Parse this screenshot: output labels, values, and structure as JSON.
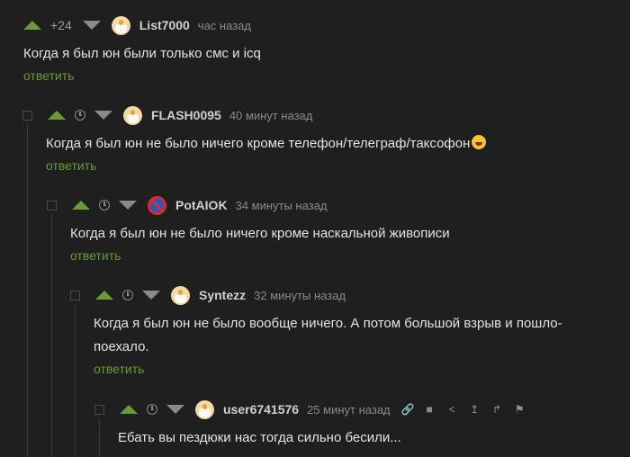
{
  "comments": [
    {
      "score": "+24",
      "author": "List7000",
      "time": "час назад",
      "text": "Когда я был юн были только смс и icq",
      "reply_label": "ответить"
    },
    {
      "author": "FLASH0095",
      "time": "40 минут назад",
      "text": "Когда я был юн не было ничего кроме телефон/телеграф/таксофон",
      "reply_label": "ответить"
    },
    {
      "author": "PotAIOK",
      "time": "34 минуты назад",
      "text": "Когда я был юн не было ничего кроме наскальной живописи",
      "reply_label": "ответить"
    },
    {
      "author": "Syntezz",
      "time": "32 минуты назад",
      "text_line1": "Когда я был юн не было вообще ничего. А потом большой взрыв и пошло-",
      "text_line2": "поехало.",
      "reply_label": "ответить"
    },
    {
      "author": "user6741576",
      "time": "25 минут назад",
      "text": "Ебать вы пездюки нас тогда сильно бесили...",
      "action_icons": [
        "link-icon",
        "save-icon",
        "share-icon",
        "scroll-up-icon",
        "branch-icon",
        "flag-icon"
      ]
    }
  ]
}
